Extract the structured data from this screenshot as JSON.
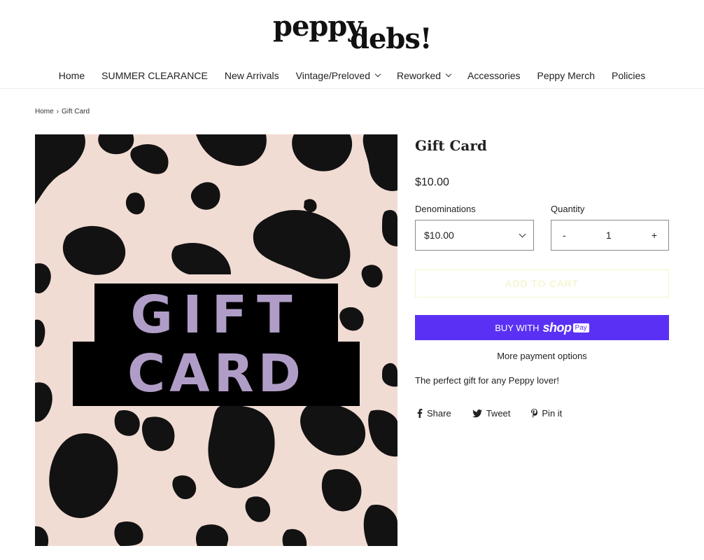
{
  "logo": {
    "word1": "peppy",
    "word2": "debs!"
  },
  "nav": {
    "items": [
      {
        "label": "Home",
        "dropdown": false
      },
      {
        "label": "SUMMER CLEARANCE",
        "dropdown": false
      },
      {
        "label": "New Arrivals",
        "dropdown": false
      },
      {
        "label": "Vintage/Preloved",
        "dropdown": true
      },
      {
        "label": "Reworked",
        "dropdown": true
      },
      {
        "label": "Accessories",
        "dropdown": false
      },
      {
        "label": "Peppy Merch",
        "dropdown": false
      },
      {
        "label": "Policies",
        "dropdown": false
      }
    ]
  },
  "breadcrumb": {
    "home": "Home",
    "sep": "›",
    "current": "Gift Card"
  },
  "image": {
    "line1": "GIFT",
    "line2": "CARD"
  },
  "product": {
    "title": "Gift Card",
    "price": "$10.00",
    "denominations_label": "Denominations",
    "denomination_value": "$10.00",
    "quantity_label": "Quantity",
    "qty_minus": "-",
    "qty_value": "1",
    "qty_plus": "+",
    "add_to_cart": "ADD TO CART",
    "buy_with": "BUY WITH",
    "shop_brand": "shop",
    "shop_pay": "Pay",
    "more_payment": "More payment options",
    "description": "The perfect gift for any Peppy lover!"
  },
  "social": {
    "share": "Share",
    "tweet": "Tweet",
    "pin": "Pin it"
  },
  "colors": {
    "shop_pay": "#5a31f4",
    "image_bg": "#f1dcd4",
    "gift_text": "#b09dc7"
  }
}
